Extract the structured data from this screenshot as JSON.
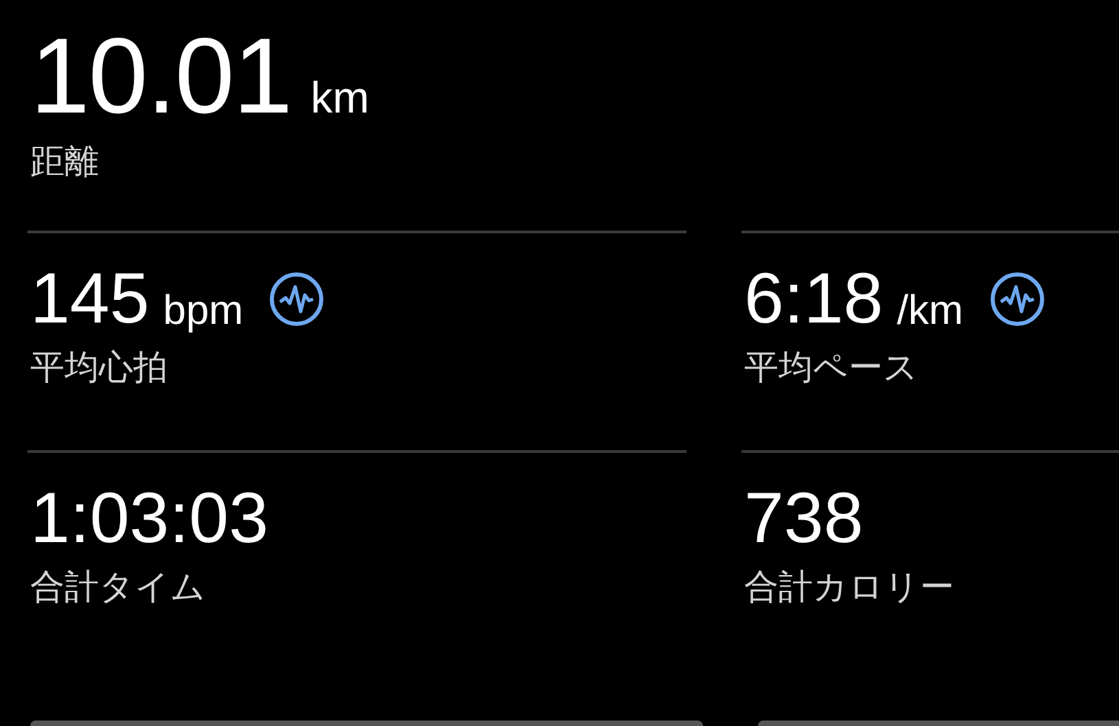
{
  "distance": {
    "value": "10.01",
    "unit": "km",
    "label": "距離"
  },
  "stats": [
    {
      "value": "145",
      "unit": "bpm",
      "label": "平均心拍",
      "chart_link": true
    },
    {
      "value": "6:18",
      "unit": "/km",
      "label": "平均ペース",
      "chart_link": true
    },
    {
      "value": "1:03:03",
      "label": "合計タイム",
      "chart_link": false
    },
    {
      "value": "738",
      "label": "合計カロリー",
      "chart_link": false
    }
  ]
}
